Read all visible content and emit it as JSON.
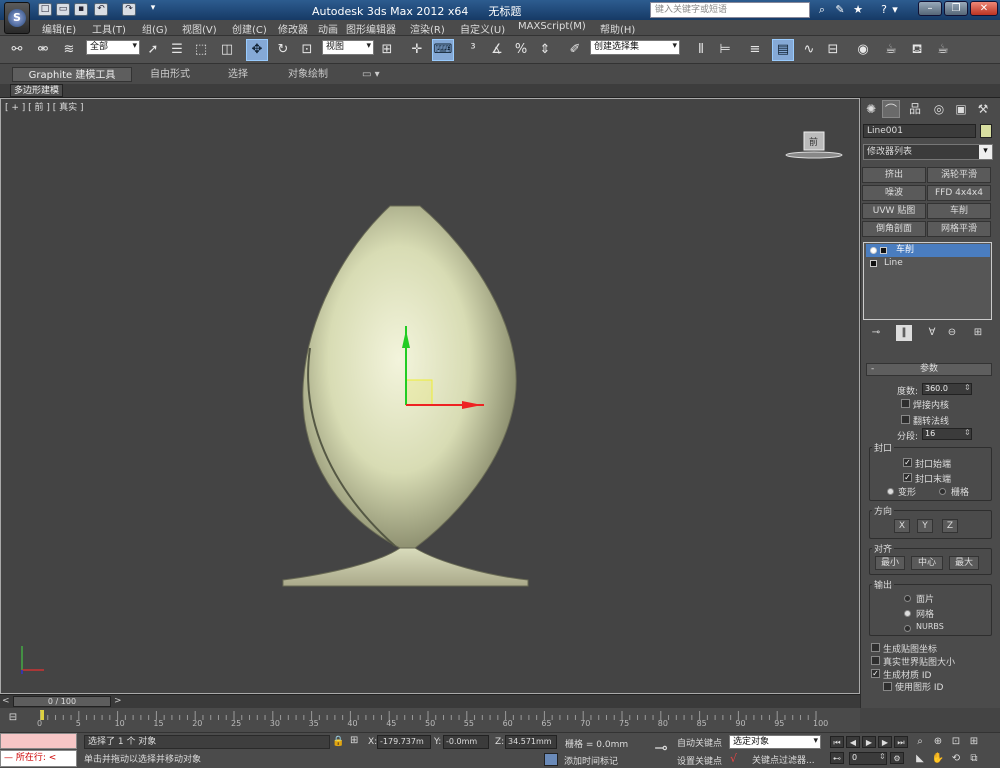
{
  "title": {
    "app": "Autodesk 3ds Max  2012 x64",
    "file": "无标题",
    "search_placeholder": "键入关键字或短语"
  },
  "menu": [
    "编辑(E)",
    "工具(T)",
    "组(G)",
    "视图(V)",
    "创建(C)",
    "修改器",
    "动画",
    "图形编辑器",
    "渲染(R)",
    "自定义(U)",
    "MAXScript(M)",
    "帮助(H)"
  ],
  "toolbar": {
    "selection_filter": "全部",
    "ref_coord": "视图",
    "named_selection": "创建选择集"
  },
  "ribbon": {
    "tabs": [
      "Graphite 建模工具",
      "自由形式",
      "选择",
      "对象绘制"
    ],
    "panel": "多边形建模"
  },
  "viewport": {
    "label": "[ + ] [ 前 ] [ 真实 ]",
    "viewcube_label": "前"
  },
  "command_panel": {
    "object_name": "Line001",
    "object_color": "#d8dea0",
    "modifier_list": "修改器列表",
    "modifier_buttons": [
      "挤出",
      "涡轮平滑",
      "噪波",
      "FFD 4x4x4",
      "UVW 贴图",
      "车削",
      "倒角剖面",
      "网格平滑"
    ],
    "stack": [
      {
        "label": "车削",
        "selected": true
      },
      {
        "label": "Line",
        "selected": false
      }
    ],
    "rollout_title": "参数",
    "degrees_label": "度数:",
    "degrees": "360.0",
    "weld_core": "焊接内核",
    "flip_normals": "翻转法线",
    "segments_label": "分段:",
    "segments": "16",
    "capping": {
      "title": "封口",
      "start": "封口始端",
      "end": "封口末端",
      "morph": "变形",
      "grid": "栅格"
    },
    "direction": {
      "title": "方向",
      "x": "X",
      "y": "Y",
      "z": "Z"
    },
    "align": {
      "title": "对齐",
      "min": "最小",
      "center": "中心",
      "max": "最大"
    },
    "output": {
      "title": "输出",
      "patch": "面片",
      "mesh": "网格",
      "nurbs": "NURBS"
    },
    "gen_map_coords": "生成贴图坐标",
    "real_world": "真实世界贴图大小",
    "gen_mat_ids": "生成材质 ID",
    "use_shape_ids": "使用图形 ID"
  },
  "timeline": {
    "position": "0 / 100",
    "ticks": [
      "0",
      "5",
      "10",
      "15",
      "20",
      "25",
      "30",
      "35",
      "40",
      "45",
      "50",
      "55",
      "60",
      "65",
      "70",
      "75",
      "80",
      "85",
      "90",
      "95",
      "100"
    ]
  },
  "status": {
    "maxscript_label": "所在行:",
    "selection_info": "选择了 1 个 对象",
    "prompt": "单击并拖动以选择并移动对象",
    "x_label": "X:",
    "x": "-179.737m",
    "y_label": "Y:",
    "y": "-0.0mm",
    "z_label": "Z:",
    "z": "34.571mm",
    "grid": "栅格 = 0.0mm",
    "add_time_tag": "添加时间标记",
    "auto_key": "自动关键点",
    "selected_set": "选定对象",
    "set_key": "设置关键点",
    "key_filters": "关键点过滤器...",
    "frame": "0"
  }
}
